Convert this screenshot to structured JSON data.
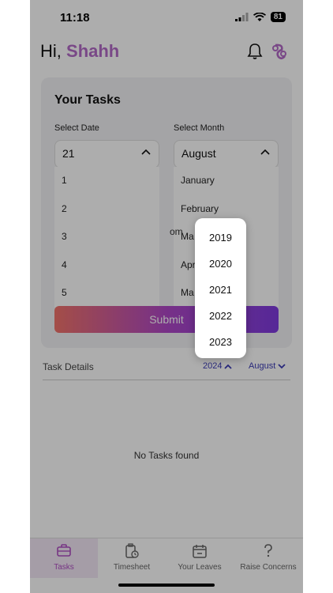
{
  "status_bar": {
    "time": "11:18",
    "battery": "81"
  },
  "header": {
    "greeting": "Hi,",
    "name": "Shahh"
  },
  "tasks_card": {
    "title": "Your Tasks",
    "date_label": "Select Date",
    "date_value": "21",
    "date_options": [
      "1",
      "2",
      "3",
      "4",
      "5"
    ],
    "month_label": "Select Month",
    "month_value": "August",
    "month_options": [
      "January",
      "February",
      "Ma",
      "Apr",
      "Ma"
    ],
    "partial_text": "om",
    "submit_label": "Submit"
  },
  "task_details": {
    "label": "Task Details",
    "year": "2024",
    "month": "August"
  },
  "empty_state": "No Tasks found",
  "tabs": [
    {
      "label": "Tasks",
      "icon": "briefcase-icon",
      "active": true
    },
    {
      "label": "Timesheet",
      "icon": "clipboard-clock-icon",
      "active": false
    },
    {
      "label": "Your Leaves",
      "icon": "calendar-minus-icon",
      "active": false
    },
    {
      "label": "Raise Concerns",
      "icon": "question-icon",
      "active": false
    }
  ],
  "year_popup": {
    "options": [
      "2019",
      "2020",
      "2021",
      "2022",
      "2023"
    ]
  },
  "colors": {
    "accent": "#b36ac7",
    "link": "#3b3bb5",
    "overlay": "rgba(0,0,0,0.32)"
  }
}
